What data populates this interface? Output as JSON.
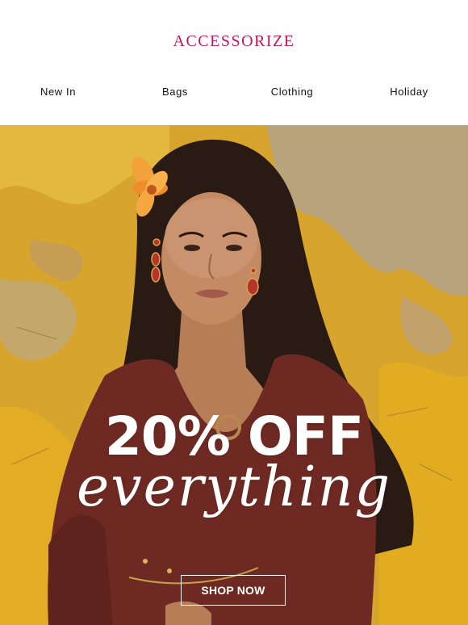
{
  "brand": {
    "logo_text": "ACCESSORIZE",
    "color": "#c2185b"
  },
  "nav": [
    {
      "label": "New In"
    },
    {
      "label": "Bags"
    },
    {
      "label": "Clothing"
    },
    {
      "label": "Holiday"
    }
  ],
  "hero": {
    "headline": "20% OFF",
    "subheadline": "everything",
    "cta_label": "SHOP NOW",
    "colors": {
      "wall": "#d9a62b",
      "dress": "#6e2a22",
      "text": "#ffffff"
    }
  }
}
